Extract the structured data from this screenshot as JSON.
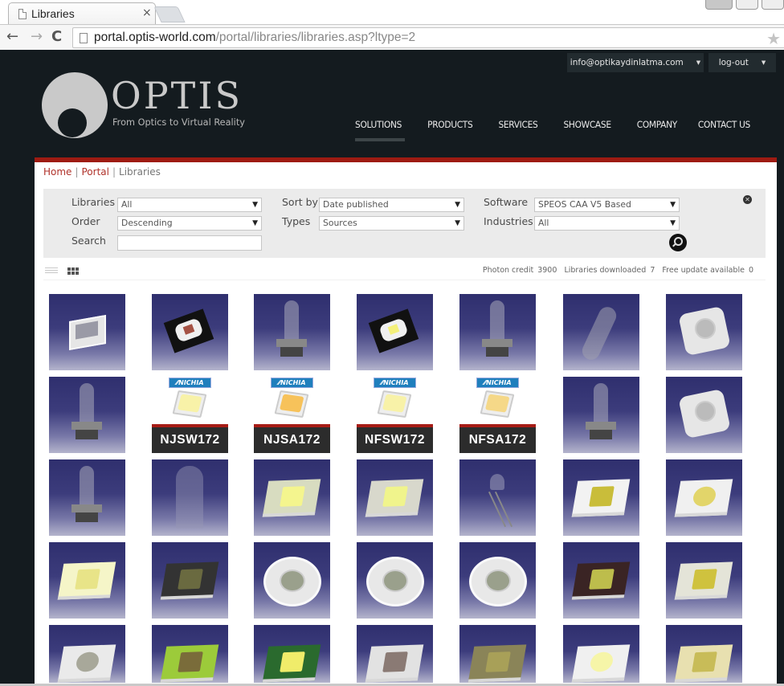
{
  "browser": {
    "tab_title": "Libraries",
    "tab_close": "×",
    "url_host": "portal.optis-world.com",
    "url_path": "/portal/libraries/libraries.asp?ltype=2",
    "back": "←",
    "forward": "→",
    "reload": "C",
    "star": "★"
  },
  "account": {
    "email": "info@optikaydinlatma.com",
    "logout": "log-out",
    "caret": "▼"
  },
  "logo": {
    "word": "OPTIS",
    "tagline": "From Optics to Virtual Reality"
  },
  "nav": {
    "items": [
      {
        "label": "SOLUTIONS",
        "active": true
      },
      {
        "label": "PRODUCTS"
      },
      {
        "label": "SERVICES"
      },
      {
        "label": "SHOWCASE"
      },
      {
        "label": "COMPANY"
      },
      {
        "label": "CONTACT US"
      }
    ]
  },
  "breadcrumb": {
    "home": "Home",
    "portal": "Portal",
    "current": "Libraries",
    "sep": "|"
  },
  "filters": {
    "libraries_label": "Libraries",
    "libraries_value": "All",
    "order_label": "Order",
    "order_value": "Descending",
    "search_label": "Search",
    "search_value": "",
    "sortby_label": "Sort by",
    "sortby_value": "Date published",
    "types_label": "Types",
    "types_value": "Sources",
    "software_label": "Software",
    "software_value": "SPEOS CAA V5 Based",
    "industries_label": "Industries",
    "industries_value": "All",
    "caret": "▼",
    "clear": "✕"
  },
  "stats": {
    "photon_credit_label": "Photon credit",
    "photon_credit_value": "3900",
    "libraries_downloaded_label": "Libraries downloaded",
    "libraries_downloaded_value": "7",
    "free_update_label": "Free update available",
    "free_update_value": "0"
  },
  "nichia": {
    "brand": "⁄⁄NICHIA"
  },
  "products": [
    {
      "kind": "smd-white-box"
    },
    {
      "kind": "led-black-red"
    },
    {
      "kind": "halogen-bulb"
    },
    {
      "kind": "led-black-yellow"
    },
    {
      "kind": "halogen-bulb-h11"
    },
    {
      "kind": "tubular-bulb"
    },
    {
      "kind": "led-white-dome"
    },
    {
      "kind": "halogen-bulb-h1"
    },
    {
      "kind": "nichia",
      "name": "NJSW172",
      "emitter": "#f8f2a8"
    },
    {
      "kind": "nichia",
      "name": "NJSA172",
      "emitter": "#f7c25a"
    },
    {
      "kind": "nichia",
      "name": "NFSW172",
      "emitter": "#f8f2a8"
    },
    {
      "kind": "nichia",
      "name": "NFSA172",
      "emitter": "#f5d888"
    },
    {
      "kind": "halogen-bulb-h4"
    },
    {
      "kind": "led-top-view"
    },
    {
      "kind": "halogen-bulb-h7"
    },
    {
      "kind": "wedge-bulb"
    },
    {
      "kind": "multi-chip-led"
    },
    {
      "kind": "multi-chip-dome"
    },
    {
      "kind": "led-5mm"
    },
    {
      "kind": "cob-square"
    },
    {
      "kind": "cob-round"
    },
    {
      "kind": "led-yellow-square"
    },
    {
      "kind": "led-dark-chip"
    },
    {
      "kind": "led-ring-module"
    },
    {
      "kind": "led-ring-module"
    },
    {
      "kind": "led-ring-module"
    },
    {
      "kind": "led-red-board"
    },
    {
      "kind": "side-view-led"
    },
    {
      "kind": "cob-grey-lens"
    },
    {
      "kind": "led-green-board"
    },
    {
      "kind": "led-green-frame"
    },
    {
      "kind": "led-3-chip"
    },
    {
      "kind": "led-gold-chip"
    },
    {
      "kind": "plcc-white"
    },
    {
      "kind": "led-flat-gold"
    }
  ]
}
